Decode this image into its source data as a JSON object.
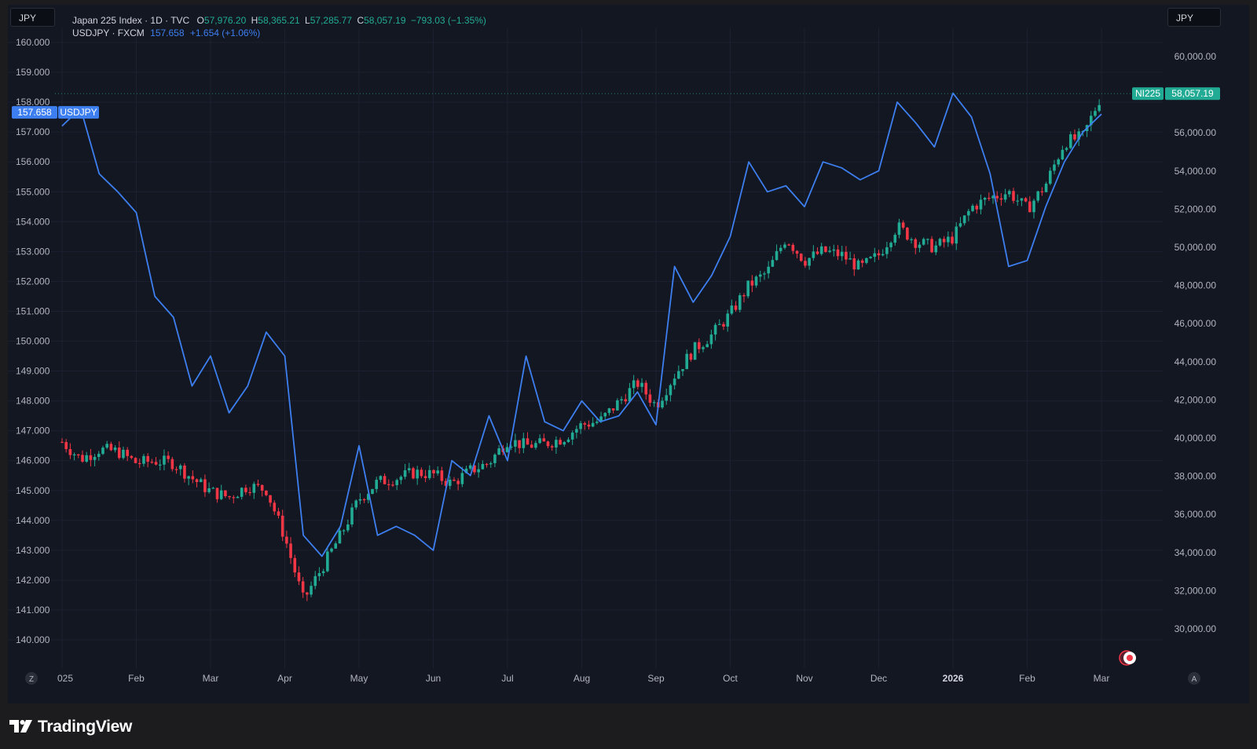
{
  "header": {
    "left_currency": "JPY",
    "right_currency": "JPY",
    "main_series": {
      "name": "Japan 225 Index · 1D · TVC",
      "open_label": "O",
      "open": "57,976.20",
      "high_label": "H",
      "high": "58,365.21",
      "low_label": "L",
      "low": "57,285.77",
      "close_label": "C",
      "close": "58,057.19",
      "change": "−793.03 (−1.35%)"
    },
    "overlay_series": {
      "name": "USDJPY · FXCM",
      "last": "157.658",
      "change": "+1.654 (+1.06%)"
    }
  },
  "price_tags": {
    "usdjpy_value": "157.658",
    "usdjpy_label": "USDJPY",
    "ni225_label": "NI225",
    "ni225_value": "58,057.19"
  },
  "bottom_bar": {
    "left_button": "Z",
    "right_button": "A"
  },
  "brand": "TradingView",
  "colors": {
    "up": "#22ab94",
    "down": "#f23645",
    "line": "#3d7ff0",
    "background": "#131722"
  },
  "chart_data": {
    "type": "line",
    "title": "",
    "x_ticks": [
      "025",
      "Feb",
      "Mar",
      "Apr",
      "May",
      "Jun",
      "Jul",
      "Aug",
      "Sep",
      "Oct",
      "Nov",
      "Dec",
      "2026",
      "Feb",
      "Mar"
    ],
    "left_axis": {
      "series": "USDJPY",
      "ticks": [
        "160.000",
        "159.000",
        "158.000",
        "157.000",
        "156.000",
        "155.000",
        "154.000",
        "153.000",
        "152.000",
        "151.000",
        "150.000",
        "149.000",
        "148.000",
        "147.000",
        "146.000",
        "145.000",
        "144.000",
        "143.000",
        "142.000",
        "141.000",
        "140.000"
      ],
      "ylim": [
        140,
        160
      ]
    },
    "right_axis": {
      "series": "NI225",
      "ticks": [
        "60,000.00",
        "56,000.00",
        "54,000.00",
        "52,000.00",
        "50,000.00",
        "48,000.00",
        "46,000.00",
        "44,000.00",
        "42,000.00",
        "40,000.00",
        "38,000.00",
        "36,000.00",
        "34,000.00",
        "32,000.00",
        "30,000.00"
      ],
      "ylim": [
        28000,
        60000
      ]
    },
    "series": [
      {
        "name": "USDJPY",
        "type": "line",
        "months": [
          0,
          0.25,
          0.5,
          0.75,
          1,
          1.25,
          1.5,
          1.75,
          2,
          2.25,
          2.5,
          2.75,
          3,
          3.25,
          3.5,
          3.75,
          4,
          4.25,
          4.5,
          4.75,
          5,
          5.25,
          5.5,
          5.75,
          6,
          6.25,
          6.5,
          6.75,
          7,
          7.25,
          7.5,
          7.75,
          8,
          8.25,
          8.5,
          8.75,
          9,
          9.25,
          9.5,
          9.75,
          10,
          10.25,
          10.5,
          10.75,
          11,
          11.25,
          11.5,
          11.75,
          12,
          12.25,
          12.5,
          12.75,
          13,
          13.25,
          13.5,
          13.75,
          14
        ],
        "values": [
          157.2,
          157.8,
          155.6,
          155.0,
          154.3,
          151.5,
          150.8,
          148.5,
          149.5,
          147.6,
          148.5,
          150.3,
          149.5,
          143.5,
          142.8,
          143.8,
          146.5,
          143.5,
          143.8,
          143.5,
          143.0,
          146.0,
          145.5,
          147.5,
          146.0,
          149.5,
          147.3,
          147.0,
          148.0,
          147.3,
          147.5,
          148.3,
          147.2,
          152.5,
          151.3,
          152.2,
          153.5,
          156.0,
          155.0,
          155.2,
          154.5,
          156.0,
          155.8,
          155.4,
          155.7,
          158.0,
          157.3,
          156.5,
          158.3,
          157.5,
          155.6,
          152.5,
          152.7,
          154.5,
          156.0,
          157.0,
          157.6
        ]
      },
      {
        "name": "NI225",
        "type": "candlestick",
        "months": [
          0,
          0.25,
          0.5,
          0.75,
          1,
          1.25,
          1.5,
          1.75,
          2,
          2.25,
          2.5,
          2.75,
          3,
          3.25,
          3.5,
          3.75,
          4,
          4.25,
          4.5,
          4.75,
          5,
          5.25,
          5.5,
          5.75,
          6,
          6.25,
          6.5,
          6.75,
          7,
          7.25,
          7.5,
          7.75,
          8,
          8.25,
          8.5,
          8.75,
          9,
          9.25,
          9.5,
          9.75,
          10,
          10.25,
          10.5,
          10.75,
          11,
          11.25,
          11.5,
          11.75,
          12,
          12.25,
          12.5,
          12.75,
          13,
          13.25,
          13.5,
          13.75,
          14
        ],
        "values": [
          39800,
          38900,
          39400,
          39300,
          38700,
          38800,
          38700,
          37900,
          37200,
          36900,
          37500,
          37300,
          34800,
          31500,
          33200,
          34900,
          36800,
          37700,
          37900,
          38200,
          38100,
          37600,
          38300,
          38700,
          39900,
          39600,
          39700,
          40000,
          40700,
          40900,
          41900,
          42900,
          41700,
          43300,
          44600,
          45400,
          46500,
          48000,
          48700,
          50500,
          49300,
          49800,
          49600,
          48900,
          49600,
          51100,
          50300,
          50000,
          50500,
          52100,
          52600,
          52900,
          52000,
          53300,
          55500,
          55800,
          58000
        ]
      }
    ]
  }
}
